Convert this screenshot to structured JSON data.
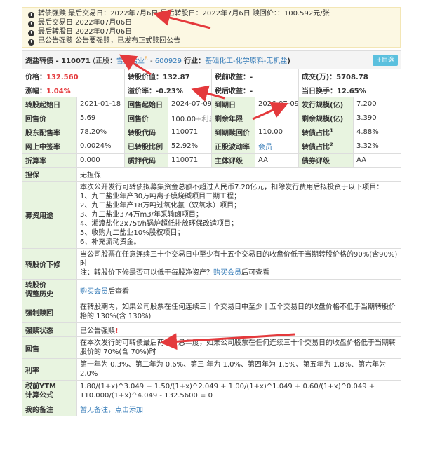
{
  "notice": {
    "line1": "转债强赎 最后交易日：2022年7月6日 最后转股日：2022年7月6日 赎回价：：100.592元/张",
    "line2": "最后交易日 2022年07月06日",
    "line3": "最后转股日 2022年07月06日",
    "line4": "已公告强赎 公告要强赎，已发布正式赎回公告"
  },
  "header": {
    "title": "湖盐转债 - 110071",
    "stock_prefix": "(正股：",
    "stock_name": "雪天盐业",
    "stock_badge": "R",
    "stock_code": "600929",
    "industry_label": "行业：",
    "industry": "基础化工-化学原料-无机盐",
    "close_paren": ")",
    "add_btn": "+自选"
  },
  "stats": {
    "price_label": "价格：",
    "price": "132.560",
    "conv_price_label": "转股价值：",
    "conv_price": "132.87",
    "pretax_label": "税前收益：",
    "pretax": "-",
    "volume_label": "成交(万)：",
    "volume": "5708.78",
    "change_label": "涨幅：",
    "change": "1.04%",
    "premium_label": "溢价率：",
    "premium": "-0.23%",
    "aftertax_label": "税后收益：",
    "aftertax": "-",
    "turnover_label": "当日换手：",
    "turnover": "12.65%"
  },
  "grid": [
    [
      "转股起始日",
      "2021-01-18",
      "回售起始日",
      "2024-07-09",
      "到期日",
      "2026-07-09",
      "发行规模(亿)",
      "7.200"
    ],
    [
      "回售价",
      "5.69",
      "回售价",
      "100.00",
      "剩余年限",
      "-",
      "剩余规模(亿)",
      "3.390"
    ],
    [
      "股东配售率",
      "78.20%",
      "转股代码",
      "110071",
      "到期赎回价",
      "110.00",
      "转债占比",
      "4.88%"
    ],
    [
      "网上中签率",
      "0.0024%",
      "已转股比例",
      "52.92%",
      "正股波动率",
      "会员",
      "转债占比",
      "3.32%"
    ],
    [
      "折算率",
      "0.000",
      "质押代码",
      "110071",
      "主体评级",
      "AA",
      "债券评级",
      "AA"
    ]
  ],
  "grid_extra": {
    "tax_note": "+利息",
    "sup1": "1",
    "sup2": "2"
  },
  "sections": {
    "guarantee_label": "担保",
    "guarantee": "无担保",
    "funds_label": "募资用途",
    "funds": [
      "本次公开发行可转债拟募集资金总额不超过人民币7.20亿元，扣除发行费用后拟投资于以下项目：",
      "1、九二盐业年产30万吨离子膜烧碱项目二期工程；",
      "2、九二盐业年产18万吨过氧化氢（双氧水）项目；",
      "3、九二盐业374万m3/年采输卤项目；",
      "4、湘渡盐化2x75t/h锅炉超低排放环保改造项目；",
      "5、收购九二盐业10%股权项目；",
      "6、补充流动资金。"
    ],
    "reset_label": "转股价下修",
    "reset_text": "当公司股票在任意连续三十个交易日中至少有十五个交易日的收盘价低于当期转股价格的90%(含90%)时",
    "reset_note_prefix": "注：转股价下修是否可以低于每股净资产？",
    "reset_note_link": "购买会员",
    "reset_note_suffix": "后可查看",
    "history_label1": "转股价",
    "history_label2": "调整历史",
    "history_link": "购买会员",
    "history_suffix": "后查看",
    "call_label": "强制赎回",
    "call_text": "在转股期内，如果公司股票在任何连续三十个交易日中至少十五个交易日的收盘价格不低于当期转股价格的 130%(含 130%)",
    "call_status_label": "强赎状态",
    "call_status": "已公告强赎",
    "call_status_mark": "!",
    "putback_label": "回售",
    "putback_text": "在本次发行的可转债最后两个计息年度，如果公司股票在任何连续三十个交易日的收盘价格低于当期转股价的 70%(含 70%)时",
    "rate_label": "利率",
    "rate_text": "第一年为 0.3%、第二年为 0.6%、第三 年为 1.0%、第四年为 1.5%、第五年为 1.8%、第六年为 2.0%",
    "ytm_label1": "税前YTM",
    "ytm_label2": "计算公式",
    "ytm_text": "1.80/(1+x)^3.049 + 1.50/(1+x)^2.049 + 1.00/(1+x)^1.049 + 0.60/(1+x)^0.049 + 110.000/(1+x)^4.049 - 132.5600 = 0",
    "memo_label": "我的备注",
    "memo_link": "暂无备注，点击添加"
  },
  "colors": {
    "accent_red": "#e4393c",
    "link_blue": "#337ab7",
    "label_bg": "#e8f4e0",
    "notice_bg": "#fcf8e3"
  }
}
